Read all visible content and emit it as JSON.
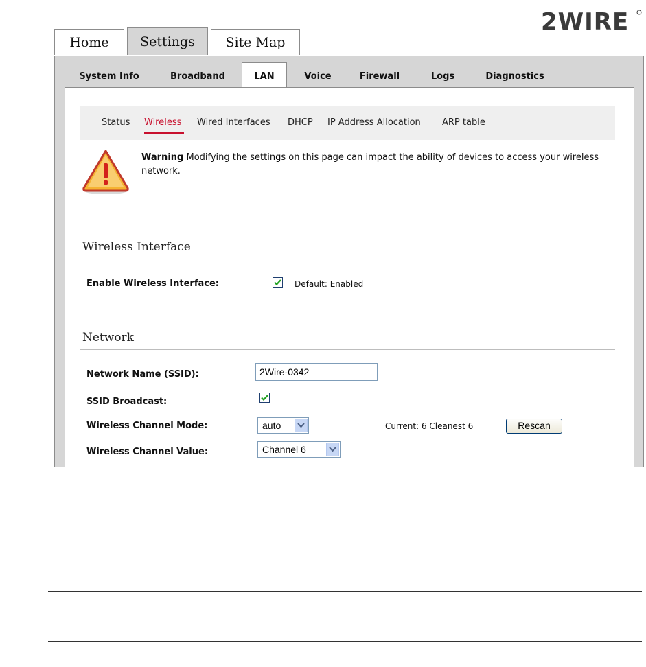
{
  "brand": {
    "logo_text": "2WIRE"
  },
  "top_tabs": [
    {
      "label": "Home"
    },
    {
      "label": "Settings"
    },
    {
      "label": "Site Map"
    }
  ],
  "sub_tabs": [
    {
      "label": "System Info"
    },
    {
      "label": "Broadband"
    },
    {
      "label": "LAN"
    },
    {
      "label": "Voice"
    },
    {
      "label": "Firewall"
    },
    {
      "label": "Logs"
    },
    {
      "label": "Diagnostics"
    }
  ],
  "lan_nav": [
    {
      "label": "Status"
    },
    {
      "label": "Wireless"
    },
    {
      "label": "Wired Interfaces"
    },
    {
      "label": "DHCP"
    },
    {
      "label": "IP Address Allocation"
    },
    {
      "label": "ARP table"
    }
  ],
  "warning": {
    "title": "Warning",
    "message": "Modifying the settings on this page can impact the ability of devices to access your wireless network."
  },
  "wireless_interface": {
    "heading": "Wireless Interface",
    "enable_label": "Enable Wireless Interface:",
    "enable_checked": true,
    "default_hint": "Default: Enabled"
  },
  "network": {
    "heading": "Network",
    "ssid_label": "Network Name (SSID):",
    "ssid_value": "2Wire-0342",
    "broadcast_label": "SSID Broadcast:",
    "broadcast_checked": true,
    "channel_mode_label": "Wireless Channel Mode:",
    "channel_mode_value": "auto",
    "channel_status": "Current:  6  Cleanest  6",
    "rescan_label": "Rescan",
    "channel_value_label": "Wireless Channel Value:",
    "channel_value": "Channel 6"
  },
  "colors": {
    "accent": "#c8102e",
    "tab_gray": "#d6d6d6",
    "nav_bar": "#efefef",
    "warning_fill": "#f5b332"
  }
}
